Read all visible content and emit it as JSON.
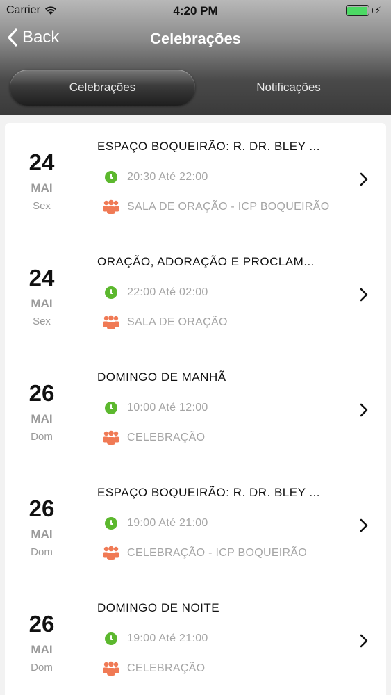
{
  "status": {
    "carrier": "Carrier",
    "time": "4:20 PM"
  },
  "nav": {
    "back_label": "Back",
    "title": "Celebrações"
  },
  "tabs": [
    {
      "label": "Celebrações",
      "active": true
    },
    {
      "label": "Notificações",
      "active": false
    }
  ],
  "events": [
    {
      "day": "24",
      "month": "MAI",
      "weekday": "Sex",
      "title": "ESPAÇO BOQUEIRÃO: R. DR. BLEY ...",
      "time": "20:30 Até 22:00",
      "place": "SALA DE ORAÇÃO - ICP BOQUEIRÃO"
    },
    {
      "day": "24",
      "month": "MAI",
      "weekday": "Sex",
      "title": "ORAÇÃO, ADORAÇÃO E PROCLAM...",
      "time": "22:00 Até 02:00",
      "place": "SALA DE ORAÇÃO"
    },
    {
      "day": "26",
      "month": "MAI",
      "weekday": "Dom",
      "title": "DOMINGO DE MANHÃ",
      "time": "10:00 Até 12:00",
      "place": "CELEBRAÇÃO"
    },
    {
      "day": "26",
      "month": "MAI",
      "weekday": "Dom",
      "title": "ESPAÇO BOQUEIRÃO: R. DR. BLEY ...",
      "time": "19:00 Até 21:00",
      "place": "CELEBRAÇÃO - ICP BOQUEIRÃO"
    },
    {
      "day": "26",
      "month": "MAI",
      "weekday": "Dom",
      "title": "DOMINGO DE NOITE",
      "time": "19:00 Até 21:00",
      "place": "CELEBRAÇÃO"
    }
  ],
  "colors": {
    "clock_icon": "#5cb82e",
    "group_icon": "#f07a55",
    "battery": "#4cd964"
  },
  "icons": {
    "time": "clock-icon",
    "place": "group-icon",
    "row_action": "chevron-right-icon"
  }
}
